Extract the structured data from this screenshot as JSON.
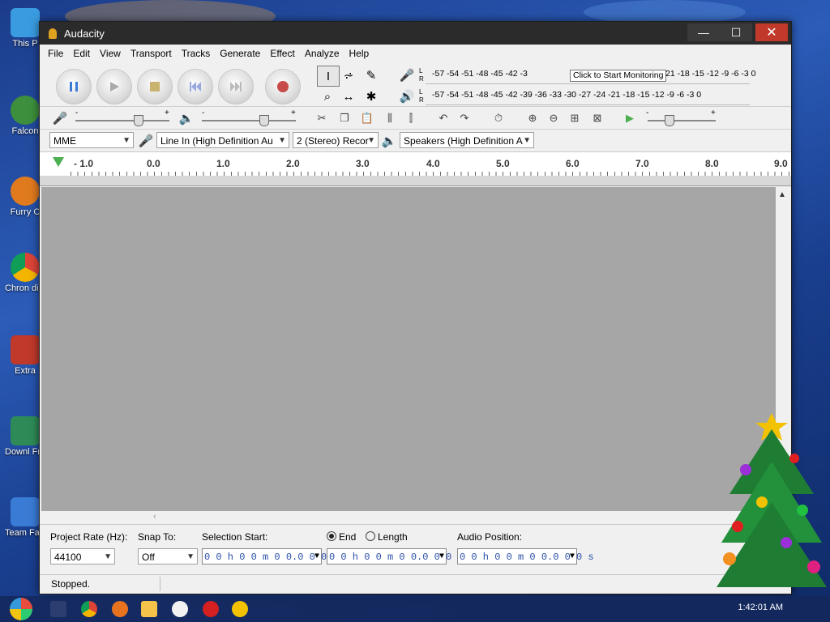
{
  "desktop": {
    "icons": [
      {
        "label": "This P",
        "color": "#3a9be0"
      },
      {
        "label": "Falcon",
        "color": "#3d8f3d"
      },
      {
        "label": "Furry C",
        "color": "#e07a1f"
      },
      {
        "label": "Chron disea",
        "color": "#d9d9d9"
      },
      {
        "label": "Extra",
        "color": "#c0392b"
      },
      {
        "label": "Downl From te",
        "color": "#2e8b57"
      },
      {
        "label": "Team Faceb",
        "color": "#3a7bd5"
      }
    ]
  },
  "window": {
    "title": "Audacity",
    "controls": {
      "minimize": "—",
      "maximize": "☐",
      "close": "✕"
    }
  },
  "menu": [
    "File",
    "Edit",
    "View",
    "Transport",
    "Tracks",
    "Generate",
    "Effect",
    "Analyze",
    "Help"
  ],
  "meters": {
    "record_scale": "-57 -54 -51 -48 -45 -42 -3",
    "record_scale_right": "21 -18 -15 -12  -9  -6  -3  0",
    "tooltip": "Click to Start Monitoring",
    "playback_scale": "-57 -54 -51 -48 -45 -42 -39 -36 -33 -30 -27 -24 -21 -18 -15 -12  -9  -6  -3  0",
    "channel_left": "L",
    "channel_right": "R"
  },
  "mixer": {
    "minus": "-",
    "plus": "+",
    "minus2": "-",
    "plus2": "+",
    "minus3": "-",
    "plus3": "+"
  },
  "devices": {
    "host": "MME",
    "recording_device": "Line In (High Definition Au",
    "channels": "2 (Stereo) Recor",
    "playback_device": "Speakers (High Definition A"
  },
  "ruler": {
    "ticks": [
      "- 1.0",
      "0.0",
      "1.0",
      "2.0",
      "3.0",
      "4.0",
      "5.0",
      "6.0",
      "7.0",
      "8.0",
      "9.0"
    ]
  },
  "selection": {
    "project_rate_label": "Project Rate (Hz):",
    "project_rate": "44100",
    "snap_label": "Snap To:",
    "snap_value": "Off",
    "start_label": "Selection Start:",
    "start_value": "0 0 h 0 0 m 0 0.0 0 0 s",
    "end_label": "End",
    "length_label": "Length",
    "end_value": "0 0 h 0 0 m 0 0.0 0 0 s",
    "audio_position_label": "Audio Position:",
    "audio_position_value": "0 0 h 0 0 m 0 0.0 0 0 s"
  },
  "status": {
    "text": "Stopped."
  },
  "taskbar": {
    "clock": "1:42:01 AM"
  }
}
